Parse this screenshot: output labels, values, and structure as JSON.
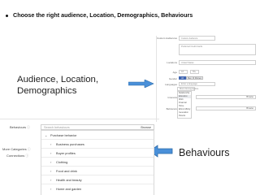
{
  "heading": "Choose the right audience, Location, Demographics, Behaviours",
  "callouts": {
    "left": [
      "Audience, Location,",
      "Demographics"
    ],
    "right": "Behaviours"
  },
  "top_form": {
    "custom_audience_label": "Custom Audiences",
    "custom_audience_placeholder": "Custom Audience",
    "custom_audience_chip": "Preferred Credit Cards",
    "locations_label": "Locations",
    "locations_chip": "United States",
    "age_label": "Age",
    "age_from": "18",
    "age_to": "65+",
    "gender_label": "Gender",
    "gender_options": [
      "All",
      "Men",
      "Women"
    ],
    "languages_label": "Languages",
    "languages_placeholder": "Enter a language",
    "more_demographics": "More Demographics",
    "demographics_list": [
      "Relationship",
      "Education",
      "Work",
      "Financial",
      "Home",
      "Ethnic Affinity",
      "Generation",
      "Parents",
      "Politics (US)",
      "Life Events"
    ],
    "interests_label": "Interests",
    "behaviors_label": "Behaviors",
    "browse": "Browse"
  },
  "behaviours_panel": {
    "behaviours_label": "Behaviours",
    "more_categories_label": "More Categories",
    "connections_label": "Connections",
    "help_icon": "ⓘ",
    "search_placeholder": "Search behaviours",
    "browse_label": "Browse",
    "categories": [
      "Purchase behavior",
      "Business purchases",
      "Buyer profiles",
      "Clothing",
      "Food and drink",
      "Health and beauty",
      "Home and garden"
    ],
    "expanded_index": 0
  }
}
